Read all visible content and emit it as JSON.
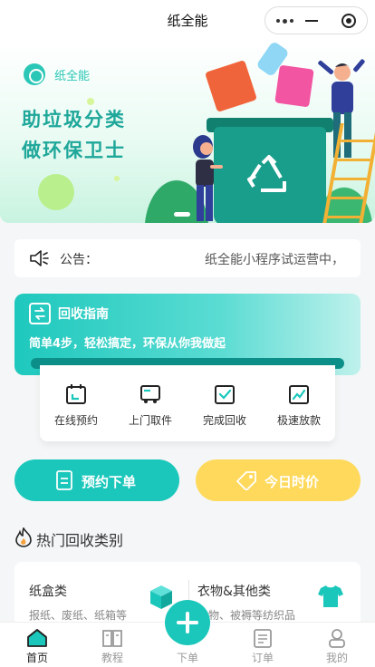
{
  "nav": {
    "title": "纸全能"
  },
  "banner": {
    "brand": "纸全能",
    "slogan_line1": "助垃圾分类",
    "slogan_line2": "做环保卫士"
  },
  "notice": {
    "label": "公告：",
    "text": "纸全能小程序试运营中，"
  },
  "guide": {
    "title": "回收指南",
    "subtitle": "简单4步，轻松搞定，环保从你我做起",
    "steps": [
      {
        "label": "在线预约",
        "icon": "calendar-icon"
      },
      {
        "label": "上门取件",
        "icon": "truck-icon"
      },
      {
        "label": "完成回收",
        "icon": "check-box-icon"
      },
      {
        "label": "极速放款",
        "icon": "trend-chart-icon"
      }
    ]
  },
  "actions": {
    "book_label": "预约下单",
    "price_label": "今日时价"
  },
  "hot": {
    "title": "热门回收类别",
    "categories": [
      {
        "name": "纸盒类",
        "desc": "报纸、废纸、纸箱等"
      },
      {
        "name": "衣物&其他类",
        "desc": "衣物、被褥等纺织品"
      }
    ]
  },
  "tabbar": {
    "items": [
      {
        "label": "首页"
      },
      {
        "label": "教程"
      },
      {
        "label": "下单"
      },
      {
        "label": "订单"
      },
      {
        "label": "我的"
      }
    ]
  },
  "colors": {
    "accent": "#1bc7bb",
    "price_button": "#ffd95b"
  }
}
